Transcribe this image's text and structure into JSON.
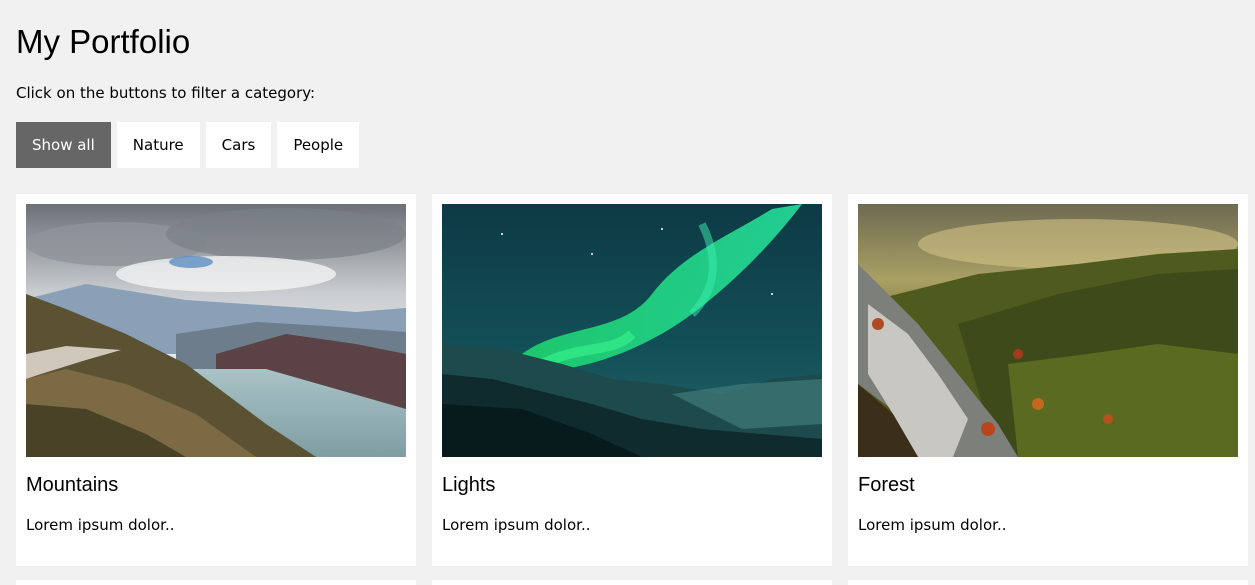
{
  "header": {
    "title": "My Portfolio"
  },
  "instructions": "Click on the buttons to filter a category:",
  "filters": [
    {
      "label": "Show all",
      "active": true
    },
    {
      "label": "Nature",
      "active": false
    },
    {
      "label": "Cars",
      "active": false
    },
    {
      "label": "People",
      "active": false
    }
  ],
  "cards": [
    {
      "title": "Mountains",
      "text": "Lorem ipsum dolor.."
    },
    {
      "title": "Lights",
      "text": "Lorem ipsum dolor.."
    },
    {
      "title": "Forest",
      "text": "Lorem ipsum dolor.."
    }
  ],
  "colors": {
    "background": "#f1f1f1",
    "active_button": "#666666",
    "card": "#ffffff"
  }
}
